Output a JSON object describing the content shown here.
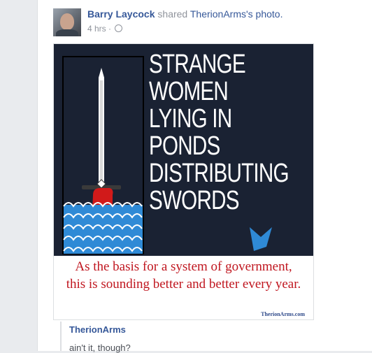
{
  "post": {
    "author": "Barry Laycock",
    "verb": " shared ",
    "source": "TherionArms's photo.",
    "time": "4 hrs · ",
    "privacy_icon": "globe-icon"
  },
  "photo": {
    "headline_lines": [
      "STRANGE",
      "WOMEN",
      "LYING IN",
      "PONDS",
      "DISTRIBUTING",
      "SWORDS"
    ],
    "caption_line1": "As the basis for a system of government,",
    "caption_line2": "this is sounding better and better every year.",
    "watermark": "TherionArms.com",
    "colors": {
      "background": "#1a2233",
      "water": "#2f8ad6",
      "hand": "#d11a1a",
      "caption": "#c0161f"
    }
  },
  "shared_from": {
    "name": "TherionArms",
    "text": "ain't it, though?"
  }
}
